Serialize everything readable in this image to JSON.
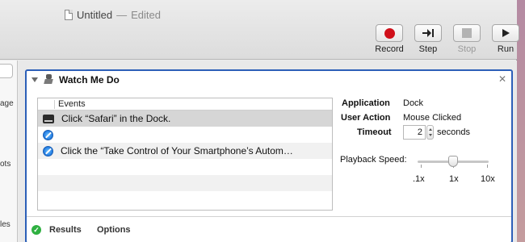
{
  "window": {
    "title": "Untitled",
    "separator": "—",
    "edited_label": "Edited"
  },
  "toolbar": {
    "record_label": "Record",
    "step_label": "Step",
    "stop_label": "Stop",
    "run_label": "Run"
  },
  "library_fragments": [
    "age",
    "ots",
    "les"
  ],
  "action": {
    "title": "Watch Me Do",
    "events_header": "Events",
    "events": [
      {
        "icon": "dock-icon",
        "text": "Click “Safari” in the Dock."
      },
      {
        "icon": "safari-icon",
        "text": ""
      },
      {
        "icon": "safari-icon",
        "text": "Click the “Take Control of Your Smartphone’s Autom…"
      }
    ],
    "properties": {
      "application_label": "Application",
      "application_value": "Dock",
      "user_action_label": "User Action",
      "user_action_value": "Mouse Clicked",
      "timeout_label": "Timeout",
      "timeout_value": "2",
      "timeout_unit": "seconds"
    },
    "playback": {
      "label": "Playback Speed:",
      "ticks": [
        ".1x",
        "1x",
        "10x"
      ],
      "value": "1x"
    },
    "footer": {
      "results_label": "Results",
      "options_label": "Options"
    }
  },
  "colors": {
    "selection_border": "#2c5fb8",
    "record_red": "#d0101a",
    "results_green": "#2fb041"
  }
}
